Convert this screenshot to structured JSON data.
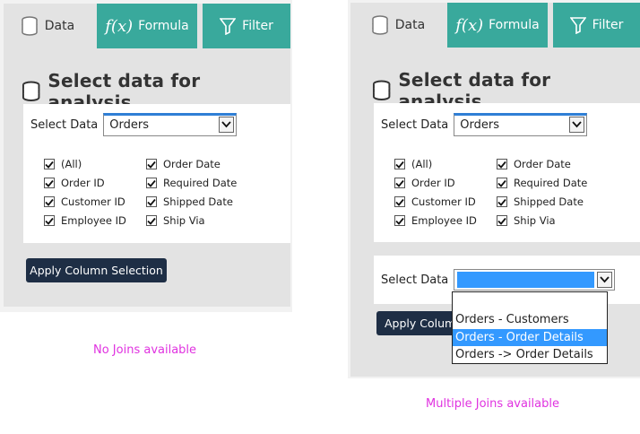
{
  "tabs": {
    "data": "Data",
    "formula": "Formula",
    "filter": "Filter"
  },
  "heading": "Select data for analysis.",
  "select_data_label": "Select Data",
  "select_value": "Orders",
  "columns": {
    "left": [
      "(All)",
      "Order ID",
      "Customer ID",
      "Employee ID"
    ],
    "right": [
      "Order Date",
      "Required Date",
      "Shipped Date",
      "Ship Via"
    ]
  },
  "apply_button": "Apply Column Selection",
  "apply_button_truncated": "Apply Colum",
  "join_options": [
    "Orders - Customers",
    "Orders - Order Details",
    "Orders -> Order Details"
  ],
  "join_selected_index": 1,
  "captions": {
    "left": "No Joins available",
    "right": "Multiple Joins available"
  },
  "colors": {
    "tab_teal": "#39a99c",
    "button_dark": "#1e2e45",
    "highlight": "#3399ff",
    "caption": "#e033e0"
  }
}
